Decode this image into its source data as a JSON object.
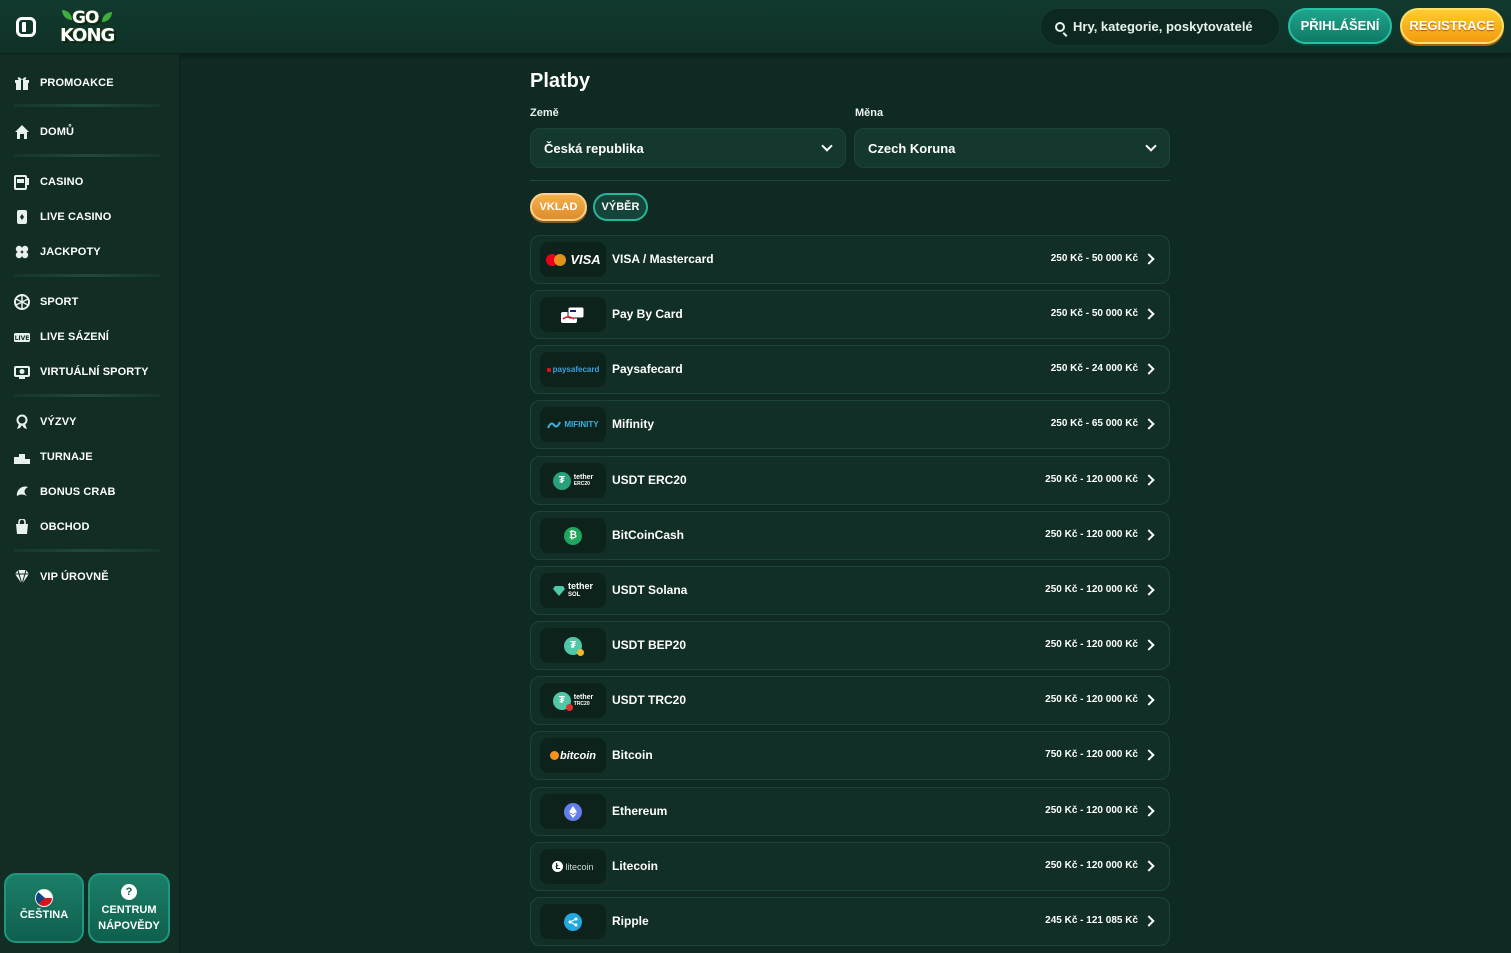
{
  "header": {
    "logo_line1": "GO",
    "logo_line2": "KONG",
    "search_placeholder": "Hry, kategorie, poskytovatelé",
    "login_label": "PŘIHLÁŠENÍ",
    "register_label": "REGISTRACE"
  },
  "sidebar": {
    "items": [
      {
        "label": "PROMOAKCE",
        "icon": "gift-icon"
      },
      {
        "label": "DOMŮ",
        "icon": "home-icon"
      },
      {
        "label": "CASINO",
        "icon": "slot-machine-icon"
      },
      {
        "label": "LIVE CASINO",
        "icon": "card-icon"
      },
      {
        "label": "JACKPOTY",
        "icon": "clover-icon"
      },
      {
        "label": "SPORT",
        "icon": "ball-icon"
      },
      {
        "label": "LIVE SÁZENÍ",
        "icon": "live-icon"
      },
      {
        "label": "VIRTUÁLNÍ SPORTY",
        "icon": "virtual-sports-icon"
      },
      {
        "label": "VÝZVY",
        "icon": "medal-icon"
      },
      {
        "label": "TURNAJE",
        "icon": "podium-icon"
      },
      {
        "label": "BONUS CRAB",
        "icon": "crab-icon"
      },
      {
        "label": "OBCHOD",
        "icon": "shop-icon"
      },
      {
        "label": "VIP ÚROVNĚ",
        "icon": "diamond-icon"
      }
    ],
    "language_label": "ČEŠTINA",
    "help_label_line1": "CENTRUM",
    "help_label_line2": "NÁPOVĚDY"
  },
  "main": {
    "title": "Platby",
    "country_label": "Země",
    "country_value": "Česká republika",
    "currency_label": "Měna",
    "currency_value": "Czech Koruna",
    "tab_deposit": "VKLAD",
    "tab_withdraw": "VÝBĚR",
    "payments": [
      {
        "name": "VISA / Mastercard",
        "range": "250 Kč - 50 000 Kč",
        "logo": "visa-mastercard"
      },
      {
        "name": "Pay By Card",
        "range": "250 Kč - 50 000 Kč",
        "logo": "paybycard"
      },
      {
        "name": "Paysafecard",
        "range": "250 Kč - 24 000 Kč",
        "logo": "paysafecard"
      },
      {
        "name": "Mifinity",
        "range": "250 Kč - 65 000 Kč",
        "logo": "mifinity"
      },
      {
        "name": "USDT ERC20",
        "range": "250 Kč - 120 000 Kč",
        "logo": "tether-erc20"
      },
      {
        "name": "BitCoinCash",
        "range": "250 Kč - 120 000 Kč",
        "logo": "bitcoincash"
      },
      {
        "name": "USDT Solana",
        "range": "250 Kč - 120 000 Kč",
        "logo": "tether-sol"
      },
      {
        "name": "USDT BEP20",
        "range": "250 Kč - 120 000 Kč",
        "logo": "tether-bep20"
      },
      {
        "name": "USDT TRC20",
        "range": "250 Kč - 120 000 Kč",
        "logo": "tether-trc20"
      },
      {
        "name": "Bitcoin",
        "range": "750 Kč - 120 000 Kč",
        "logo": "bitcoin"
      },
      {
        "name": "Ethereum",
        "range": "250 Kč - 120 000 Kč",
        "logo": "ethereum"
      },
      {
        "name": "Litecoin",
        "range": "250 Kč - 120 000 Kč",
        "logo": "litecoin"
      },
      {
        "name": "Ripple",
        "range": "245 Kč - 121 085 Kč",
        "logo": "ripple"
      }
    ],
    "logo_text": {
      "visa": "VISA",
      "paysafe": "paysafecard",
      "mifinity": "MIFINITY",
      "tether": "tether",
      "erc20": "ERC20",
      "sol": "SOL",
      "trc20": "TRC20",
      "bitcoin": "bitcoin",
      "litecoin": "litecoin"
    }
  },
  "colors": {
    "background": "#0f2a22",
    "accent_green": "#1fa58c",
    "accent_orange": "#f39a10"
  }
}
